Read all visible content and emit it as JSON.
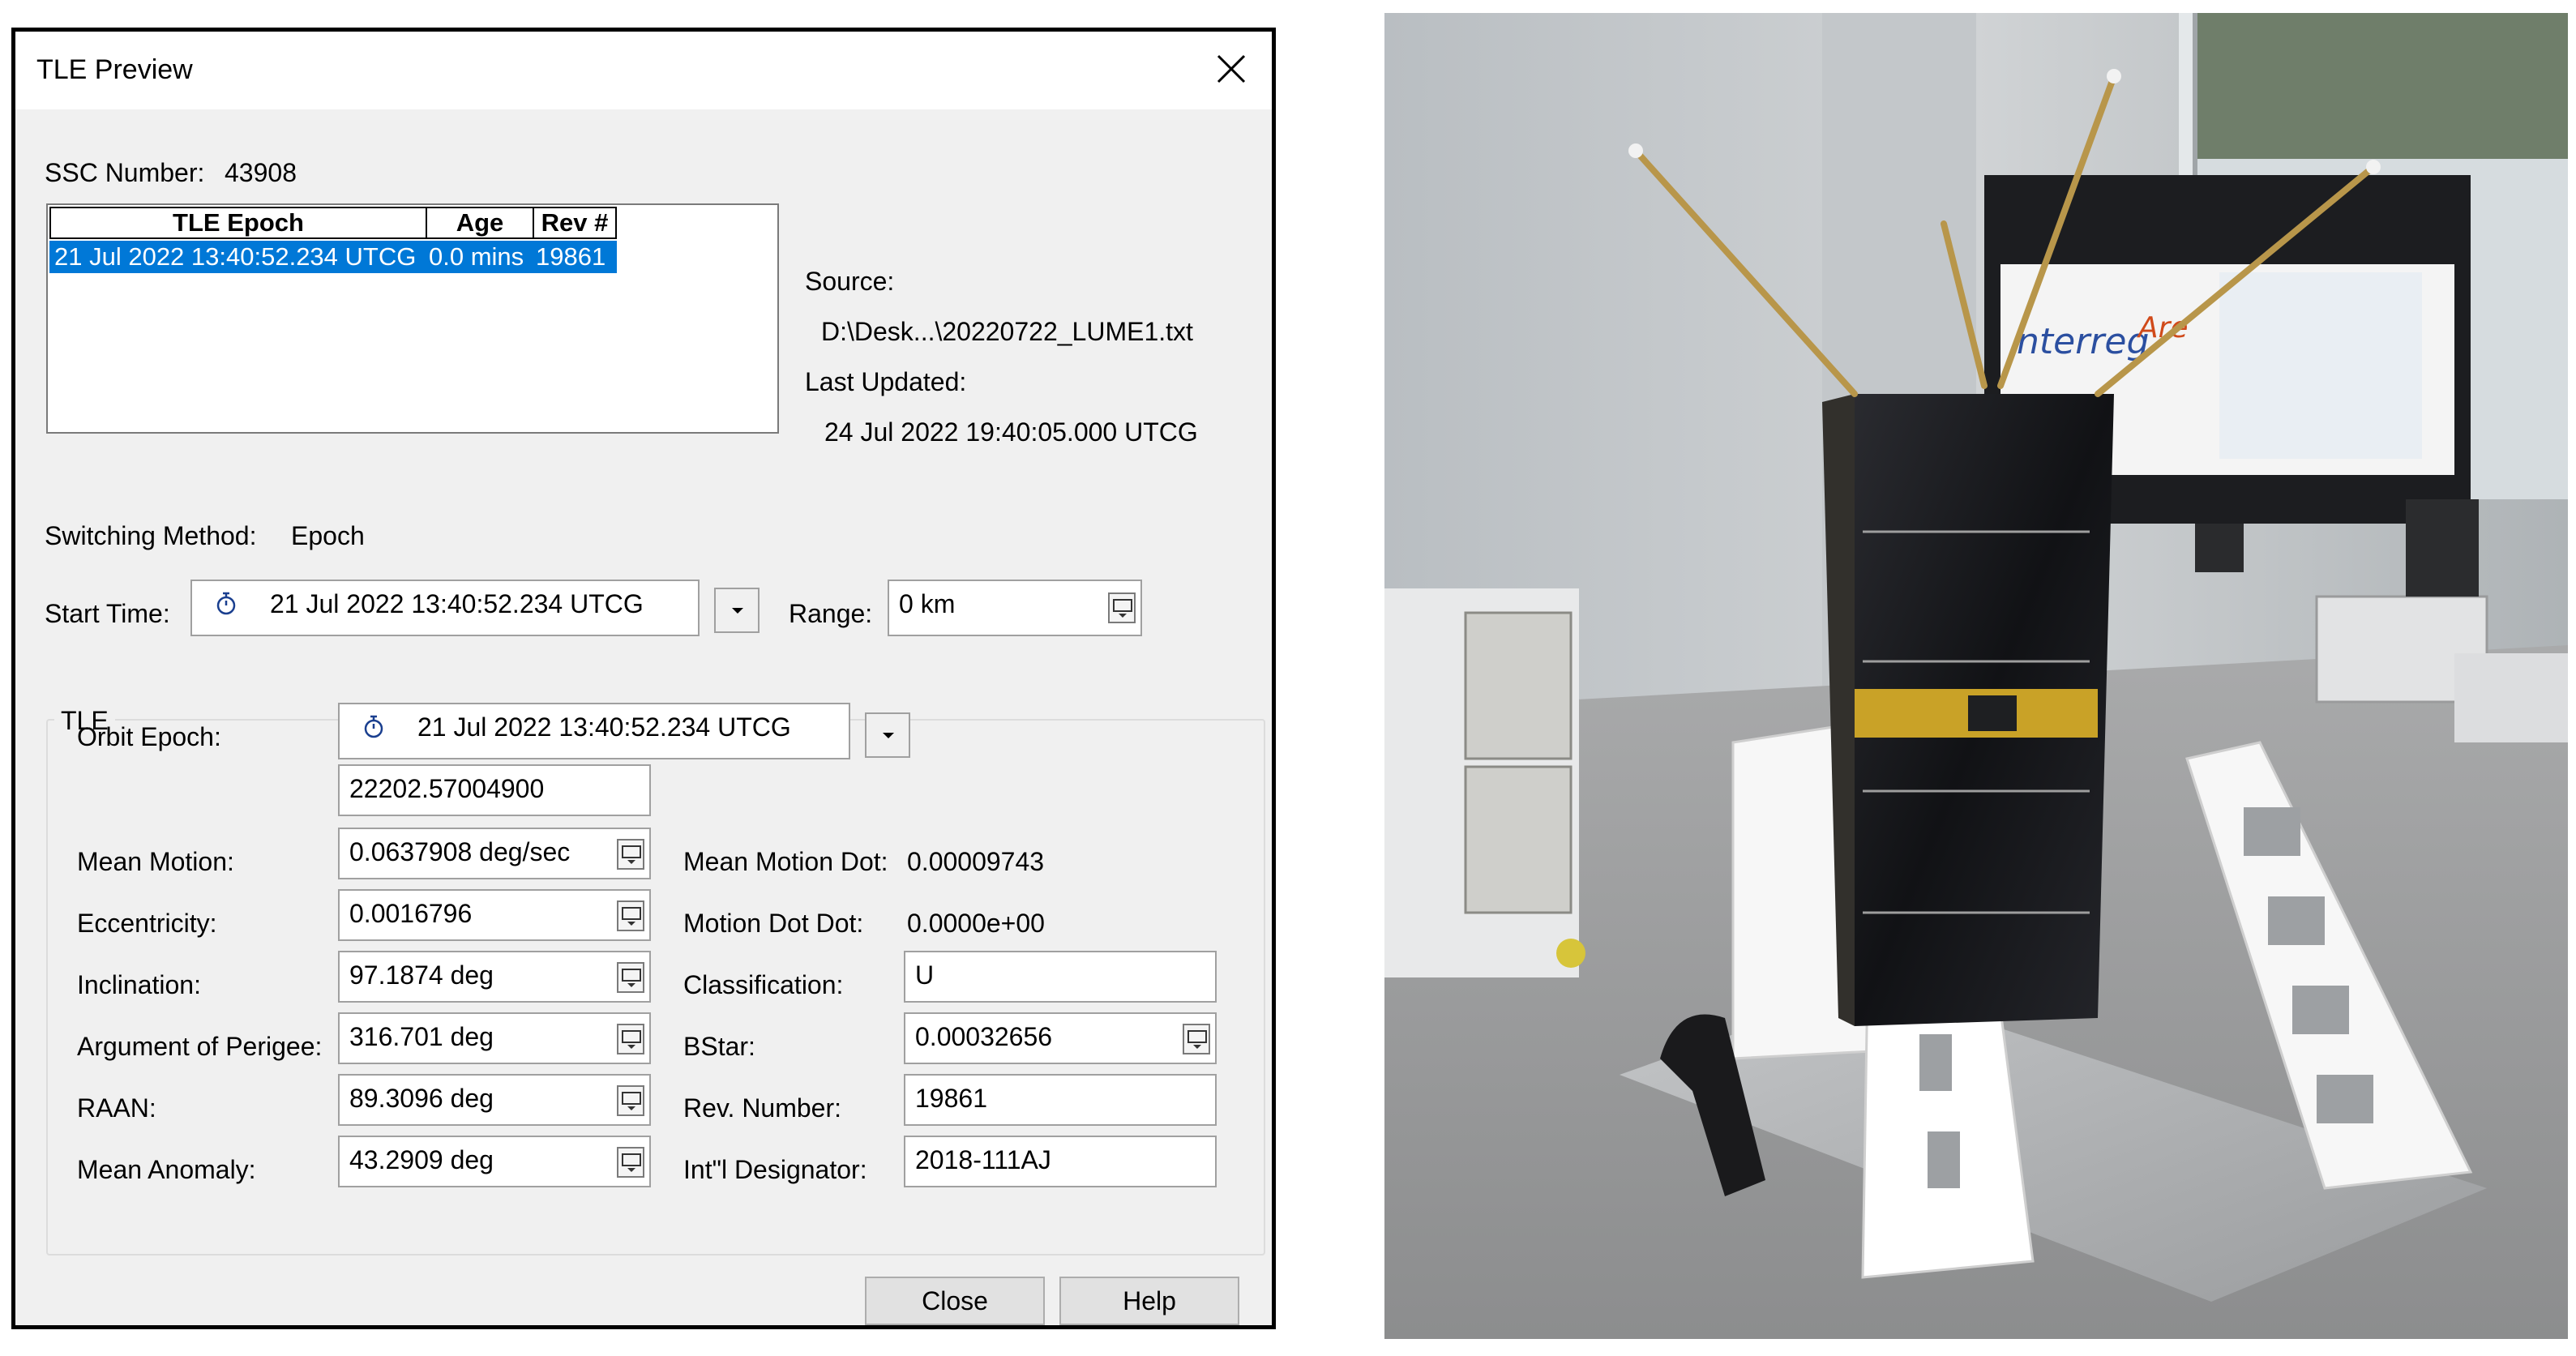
{
  "dialog": {
    "title": "TLE Preview",
    "ssc_label": "SSC Number:",
    "ssc_value": "43908",
    "tle_table": {
      "columns": [
        "TLE Epoch",
        "Age",
        "Rev #"
      ],
      "rows": [
        {
          "epoch": "21 Jul 2022 13:40:52.234 UTCG",
          "age": "0.0 mins",
          "rev": "19861"
        }
      ]
    },
    "source_label": "Source:",
    "source_value": "D:\\Desk...\\20220722_LUME1.txt",
    "last_updated_label": "Last Updated:",
    "last_updated_value": "24 Jul 2022 19:40:05.000 UTCG",
    "switching_label": "Switching Method:",
    "switching_value": "Epoch",
    "start_time_label": "Start Time:",
    "start_time_value": "21 Jul 2022 13:40:52.234 UTCG",
    "range_label": "Range:",
    "range_value": "0 km",
    "tle_group_label": "TLE",
    "orbit_epoch_label": "Orbit Epoch:",
    "orbit_epoch_value": "21 Jul 2022 13:40:52.234 UTCG",
    "orbit_epoch_numeric": "22202.57004900",
    "left_fields": [
      {
        "label": "Mean Motion:",
        "value": "0.0637908 deg/sec"
      },
      {
        "label": "Eccentricity:",
        "value": "0.0016796"
      },
      {
        "label": "Inclination:",
        "value": "97.1874 deg"
      },
      {
        "label": "Argument of Perigee:",
        "value": "316.701 deg"
      },
      {
        "label": "RAAN:",
        "value": "89.3096 deg"
      },
      {
        "label": "Mean Anomaly:",
        "value": "43.2909 deg"
      }
    ],
    "right_static": [
      {
        "label": "Mean Motion Dot:",
        "value": "0.00009743"
      },
      {
        "label": "Motion Dot Dot:",
        "value": "0.0000e+00"
      }
    ],
    "right_fields": [
      {
        "label": "Classification:",
        "value": "U"
      },
      {
        "label": "BStar:",
        "value": "0.00032656"
      },
      {
        "label": "Rev. Number:",
        "value": "19861"
      },
      {
        "label": "Int\"l Designator:",
        "value": "2018-111AJ"
      }
    ],
    "close_button": "Close",
    "help_button": "Help"
  },
  "photo": {
    "subject": "cubesat-on-stand",
    "poster_text_1": "nterreg",
    "poster_text_2": "Are"
  },
  "colors": {
    "selection": "#0078d7",
    "dialog_bg": "#f0f0f0",
    "solar_panel": "#15161a",
    "gold": "#c9a227",
    "stand": "#ffffff"
  }
}
